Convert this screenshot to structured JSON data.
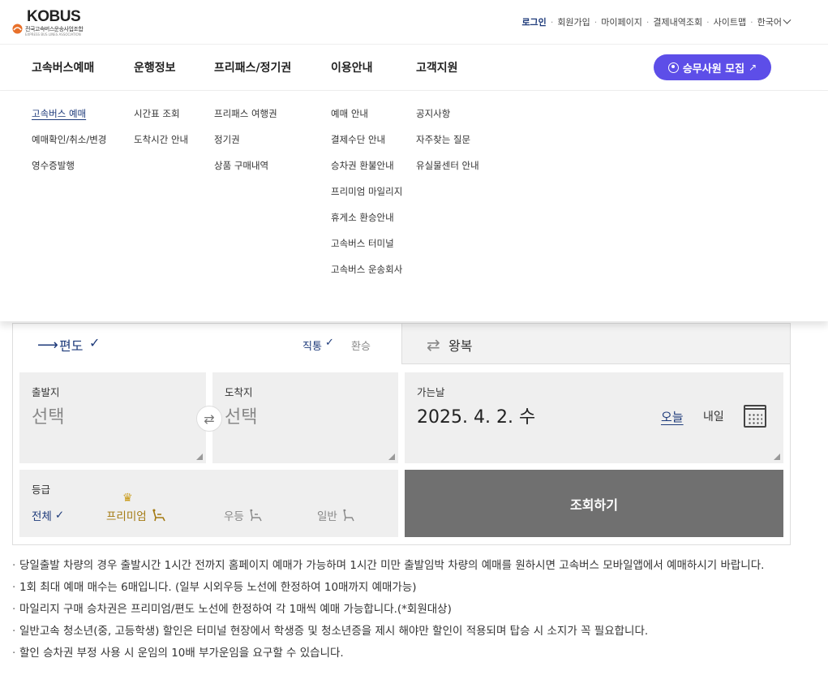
{
  "logo": {
    "brand": "KOBUS",
    "subtitle": "전국고속버스운송사업조합",
    "subtitle2": "EXPRESS BUS LINES ASSOCIATION"
  },
  "utility": {
    "login": "로그인",
    "signup": "회원가입",
    "mypage": "마이페이지",
    "payments": "결제내역조회",
    "sitemap": "사이트맵",
    "language": "한국어"
  },
  "nav": {
    "items": [
      "고속버스예매",
      "운행정보",
      "프리패스/정기권",
      "이용안내",
      "고객지원"
    ],
    "recruit": "승무사원 모집",
    "recruit_arrow": "↗"
  },
  "mega": {
    "col1": [
      "고속버스 예매",
      "예매확인/취소/변경",
      "영수증발행"
    ],
    "col2": [
      "시간표 조회",
      "도착시간 안내"
    ],
    "col3": [
      "프리패스 여행권",
      "정기권",
      "상품 구매내역"
    ],
    "col4": [
      "예매 안내",
      "결제수단 안내",
      "승차권 환불안내",
      "프리미엄 마일리지",
      "휴게소 환승안내",
      "고속버스 터미널",
      "고속버스 운송회사"
    ],
    "col5": [
      "공지사항",
      "자주찾는 질문",
      "유실물센터 안내"
    ]
  },
  "booking": {
    "tab_oneway": "편도",
    "tab_round": "왕복",
    "opt_direct": "직통",
    "opt_transfer": "환승",
    "check": "✓",
    "departure_label": "출발지",
    "departure_value": "선택",
    "arrival_label": "도착지",
    "arrival_value": "선택",
    "date_label": "가는날",
    "date_value": "2025. 4. 2. 수",
    "today": "오늘",
    "tomorrow": "내일",
    "grade_label": "등급",
    "grades": {
      "all": "전체",
      "premium": "프리미엄",
      "wd": "우등",
      "normal": "일반"
    },
    "search": "조회하기"
  },
  "notices": [
    "당일출발 차량의 경우 출발시간 1시간 전까지 홈페이지 예매가 가능하며 1시간 미만 출발임박 차량의 예매를 원하시면 고속버스 모바일앱에서 예매하시기 바랍니다.",
    "1회 최대 예매 매수는 6매입니다. (일부 시외우등 노선에 한정하여 10매까지 예매가능)",
    "마일리지 구매 승차권은 프리미엄/편도 노선에 한정하여 각 1매씩 예매 가능합니다.(*회원대상)",
    "일반고속 청소년(중, 고등학생) 할인은 터미널 현장에서 학생증 및 청소년증을 제시 해야만 할인이 적용되며 탑승 시 소지가 꼭 필요합니다.",
    "할인 승차권 부정 사용 시 운임의 10배 부가운임을 요구할 수 있습니다."
  ],
  "colors": {
    "primary": "#1d3a7a",
    "accent": "#5d4ee8",
    "premium": "#a47a12",
    "search_bg": "#707070"
  }
}
